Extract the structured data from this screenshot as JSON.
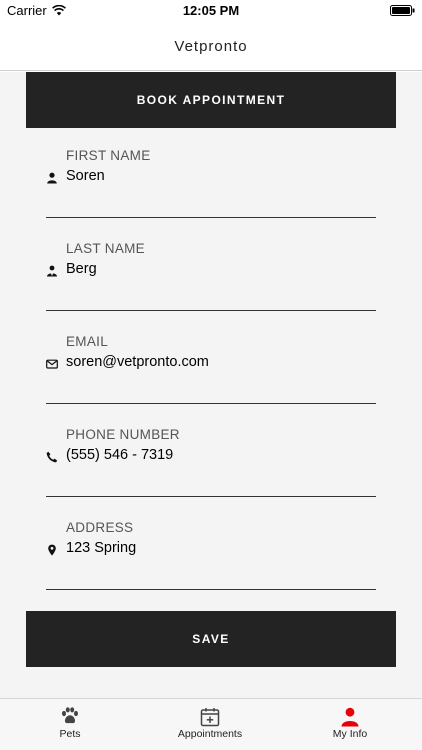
{
  "status_bar": {
    "carrier": "Carrier",
    "time": "12:05 PM"
  },
  "nav": {
    "title": "Vetpronto"
  },
  "book_button": {
    "label": "BOOK APPOINTMENT"
  },
  "fields": {
    "first_name": {
      "label": "FIRST NAME",
      "value": "Soren",
      "icon": "person-icon"
    },
    "last_name": {
      "label": "LAST NAME",
      "value": "Berg",
      "icon": "person-tie-icon"
    },
    "email": {
      "label": "EMAIL",
      "value": "soren@vetpronto.com",
      "icon": "envelope-icon"
    },
    "phone": {
      "label": "PHONE NUMBER",
      "value": "(555) 546 - 7319",
      "icon": "phone-icon"
    },
    "address": {
      "label": "ADDRESS",
      "value": "123 Spring",
      "icon": "map-pin-icon"
    }
  },
  "save_button": {
    "label": "SAVE"
  },
  "tabs": [
    {
      "label": "Pets",
      "icon": "paw-icon",
      "selected": false
    },
    {
      "label": "Appointments",
      "icon": "calendar-add-icon",
      "selected": false
    },
    {
      "label": "My Info",
      "icon": "person-icon",
      "selected": true
    }
  ],
  "colors": {
    "accent": "#e8000b",
    "button_bg": "#232323",
    "content_bg": "#f4f4f4"
  }
}
